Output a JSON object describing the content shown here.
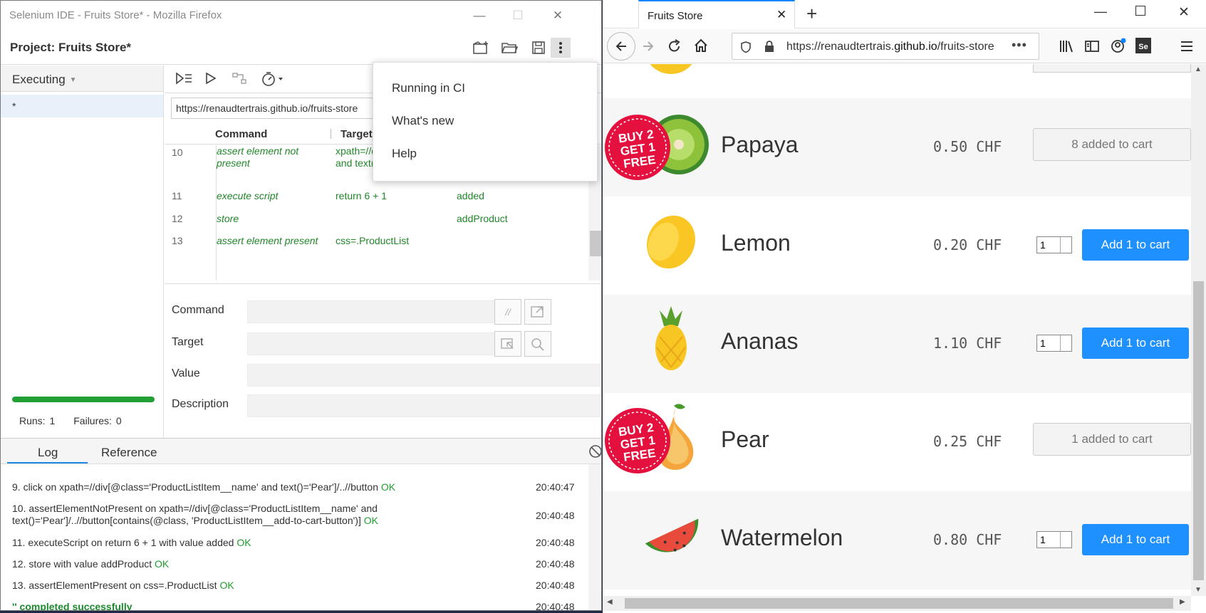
{
  "ide": {
    "window_title": "Selenium IDE - Fruits Store* - Mozilla Firefox",
    "project_label": "Project:  Fruits Store*",
    "sidebar": {
      "mode": "Executing",
      "selected_item": "*"
    },
    "base_url": "https://renaudtertrais.github.io/fruits-store",
    "grid": {
      "headers": [
        "Command",
        "Target"
      ],
      "rows": [
        {
          "num": "10",
          "command": "assert element not present",
          "target": "xpath=//div[@class='ProductListItem__name' and text()='Pea…",
          "value": ""
        },
        {
          "num": "11",
          "command": "execute script",
          "target": "return 6 + 1",
          "value": "added"
        },
        {
          "num": "12",
          "command": "store",
          "target": "",
          "value": "addProduct"
        },
        {
          "num": "13",
          "command": "assert element present",
          "target": "css=.ProductList",
          "value": ""
        }
      ]
    },
    "form": {
      "command_label": "Command",
      "target_label": "Target",
      "value_label": "Value",
      "description_label": "Description",
      "comment_btn": "//"
    },
    "stats": {
      "runs": "Runs: 1",
      "failures": "Failures: 0"
    },
    "tabs": {
      "log": "Log",
      "reference": "Reference"
    },
    "log": [
      {
        "text": "9.  click on xpath=//div[@class='ProductListItem__name' and text()='Pear']/..//button",
        "status": "OK",
        "time": "20:40:47"
      },
      {
        "text": "10. assertElementNotPresent on xpath=//div[@class='ProductListItem__name' and text()='Pear']/..//button[contains(@class, 'ProductListItem__add-to-cart-button')]",
        "status": "OK",
        "time": "20:40:48"
      },
      {
        "text": "11.  executeScript on return 6 + 1 with value added",
        "status": "OK",
        "time": "20:40:48"
      },
      {
        "text": "12.  store with value addProduct",
        "status": "OK",
        "time": "20:40:48"
      },
      {
        "text": "13.  assertElementPresent on css=.ProductList",
        "status": "OK",
        "time": "20:40:48"
      }
    ],
    "log_done": {
      "text": "'' completed successfully",
      "time": "20:40:48"
    },
    "menu": [
      "Running in CI",
      "What's new",
      "Help"
    ]
  },
  "firefox": {
    "tab_title": "Fruits Store",
    "url_prefix": "https://renaudtertrais.",
    "url_host": "github.io",
    "url_rest": "/fruits-store",
    "products": [
      {
        "name": "Papaya",
        "price": "0.50 CHF",
        "state": "added",
        "added_label": "8 added to cart",
        "promo": "BUY 2 GET 1 FREE"
      },
      {
        "name": "Lemon",
        "price": "0.20 CHF",
        "state": "add",
        "qty": "1",
        "button": "Add 1 to cart"
      },
      {
        "name": "Ananas",
        "price": "1.10 CHF",
        "state": "add",
        "qty": "1",
        "button": "Add 1 to cart"
      },
      {
        "name": "Pear",
        "price": "0.25 CHF",
        "state": "added",
        "added_label": "1 added to cart",
        "promo": "BUY 2 GET 1 FREE"
      },
      {
        "name": "Watermelon",
        "price": "0.80 CHF",
        "state": "add",
        "qty": "1",
        "button": "Add 1 to cart"
      }
    ]
  }
}
